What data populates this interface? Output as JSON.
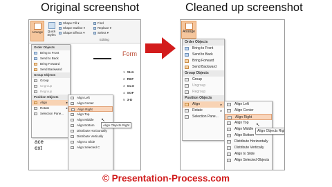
{
  "captions": {
    "left": "Original screenshot",
    "right": "Cleaned up screenshot"
  },
  "footer": "© Presentation-Process.com",
  "colors": {
    "arrow": "#d31c1c",
    "footer": "#d01a1a",
    "highlight": "#f8d3b4"
  },
  "original": {
    "ribbon": {
      "arrange_label": "Arrange",
      "quick_styles_label": "Quick Styles",
      "shape_commands": [
        "Shape Fill",
        "Shape Outline",
        "Shape Effects"
      ],
      "edit_commands": [
        "Find",
        "Replace",
        "Select"
      ],
      "editing_label": "Editing"
    },
    "doc": {
      "heading_fragment": "Form",
      "list_bullets": [
        "1",
        "2",
        "3",
        "4",
        "5"
      ],
      "list_items": [
        "SHA",
        "REF",
        "GLO",
        "SOF",
        "3-D"
      ],
      "bottom_line1": "ace",
      "bottom_line2": "ext"
    },
    "menu": {
      "order_header": "Order Objects",
      "order_items": [
        "Bring to Front",
        "Send to Back",
        "Bring Forward",
        "Send Backward"
      ],
      "group_header": "Group Objects",
      "group_items": [
        "Group",
        "Ungroup",
        "Regroup"
      ],
      "position_header": "Position Objects",
      "position_items": [
        "Align",
        "Rotate",
        "Selection Pane..."
      ]
    },
    "submenu": {
      "items": [
        "Align Left",
        "Align Center",
        "Align Right",
        "Align Top",
        "Align Middle",
        "Align Bottom",
        "Distribute Horizontally",
        "Distribute Vertically",
        "Align to Slide",
        "Align Selected C"
      ],
      "tooltip": "Align Objects Right"
    }
  },
  "cleaned": {
    "arrange_label": "Arrange",
    "menu": {
      "order_header": "Order Objects",
      "order_items": [
        "Bring to Front",
        "Send to Back",
        "Bring Forward",
        "Send Backward"
      ],
      "group_header": "Group Objects",
      "group_items": [
        "Group",
        "Ungroup",
        "Regroup"
      ],
      "position_header": "Position Objects",
      "position_items": [
        "Align",
        "Rotate",
        "Selection Pane..."
      ]
    },
    "submenu": {
      "items": [
        "Align Left",
        "Align Center",
        "Align Right",
        "Align Top",
        "Align Middle",
        "Align Bottom",
        "Distribute Horizontally",
        "Distribute Vertically",
        "Align to Slide",
        "Align Selected Objects"
      ],
      "tooltip": "Align Objects Right"
    }
  }
}
